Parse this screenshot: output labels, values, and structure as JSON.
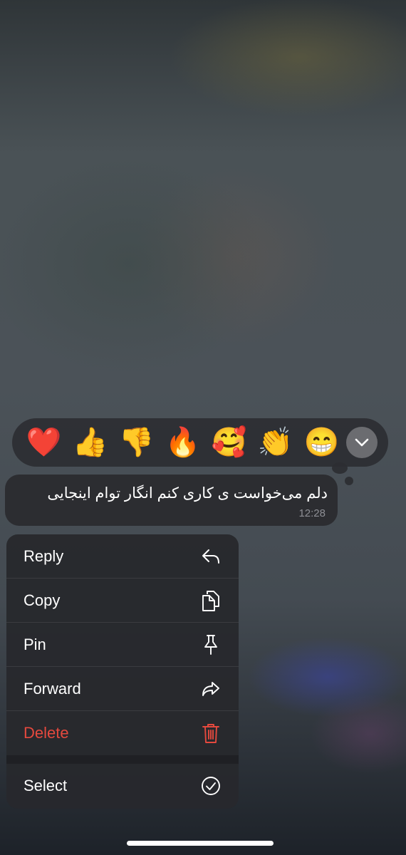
{
  "reactions": [
    {
      "emoji": "❤️",
      "icon": "red-heart"
    },
    {
      "emoji": "👍",
      "icon": "thumbs-up"
    },
    {
      "emoji": "👎",
      "icon": "thumbs-down"
    },
    {
      "emoji": "🔥",
      "icon": "fire"
    },
    {
      "emoji": "🥰",
      "icon": "smiling-face-with-hearts"
    },
    {
      "emoji": "👏",
      "icon": "clapping-hands"
    },
    {
      "emoji": "😁",
      "icon": "beaming-face"
    }
  ],
  "message": {
    "text": "دلم می‌خواست ی کاری کنم انگار توام اینجایی",
    "time": "12:28"
  },
  "menu": {
    "reply": "Reply",
    "copy": "Copy",
    "pin": "Pin",
    "forward": "Forward",
    "delete": "Delete",
    "select": "Select"
  },
  "colors": {
    "menu_bg": "#28292d",
    "danger": "#e5493e",
    "bubble_bg": "#2c2d31",
    "time_text": "#8e8f95"
  }
}
